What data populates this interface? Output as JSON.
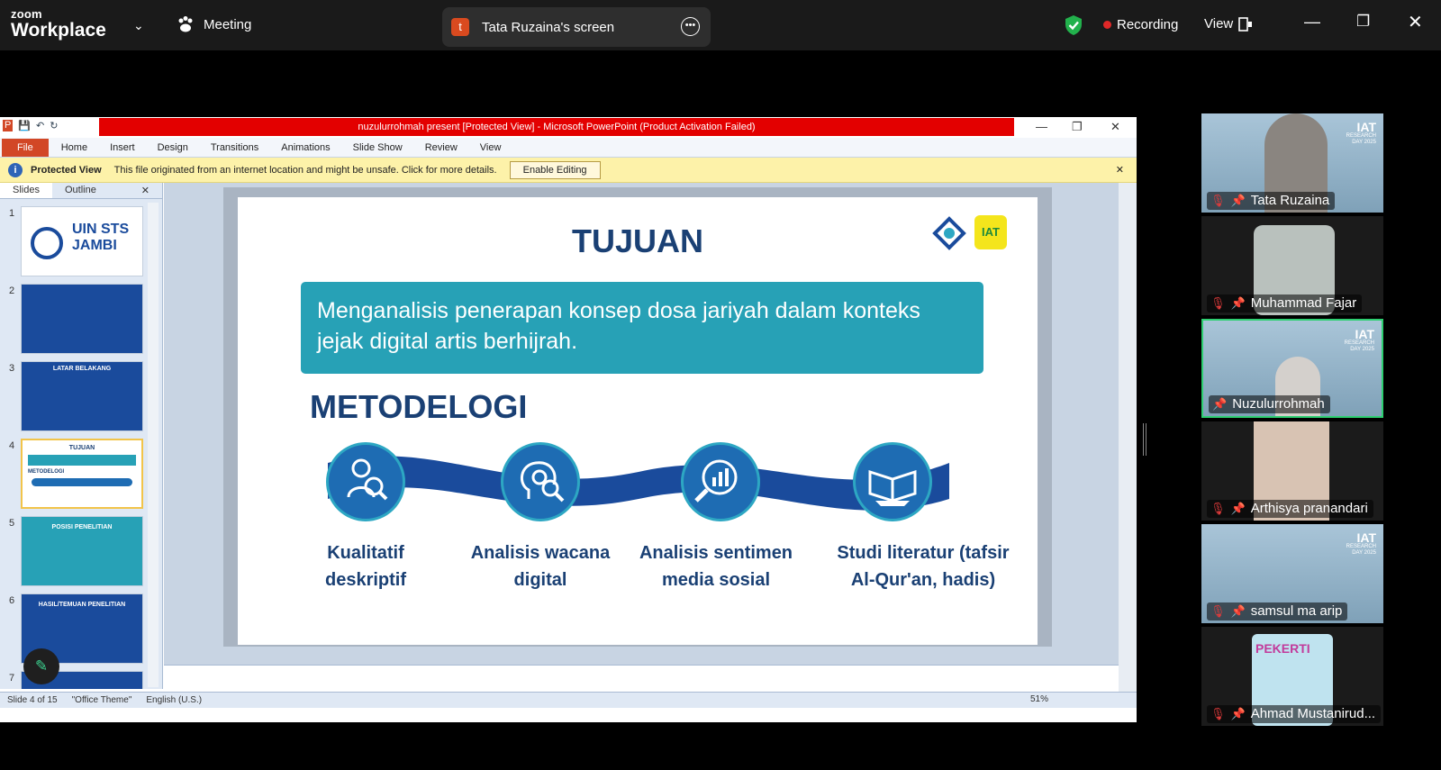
{
  "zoom": {
    "brand_top": "zoom",
    "brand_bottom": "Workplace",
    "meeting_label": "Meeting",
    "share_initial": "t",
    "share_label": "Tata Ruzaina's screen",
    "recording_label": "Recording",
    "view_label": "View"
  },
  "ppt": {
    "window_title": "nuzulurrohmah present [Protected View] - Microsoft PowerPoint (Product Activation Failed)",
    "ribbon_tabs": [
      "File",
      "Home",
      "Insert",
      "Design",
      "Transitions",
      "Animations",
      "Slide Show",
      "Review",
      "View"
    ],
    "protected_label": "Protected View",
    "protected_message": "This file originated from an internet location and might be unsafe. Click for more details.",
    "enable_editing": "Enable Editing",
    "panel_tabs": [
      "Slides",
      "Outline"
    ],
    "slide_numbers": [
      "1",
      "2",
      "3",
      "4",
      "5",
      "6",
      "7"
    ],
    "thumb1_line1": "UIN STS",
    "thumb1_line2": "JAMBI",
    "thumb3_title": "LATAR BELAKANG",
    "thumb4_title": "TUJUAN",
    "thumb4_sub": "METODELOGI",
    "thumb5_title": "POSISI PENELITIAN",
    "thumb6_title": "HASIL/TEMUAN PENELITIAN",
    "status_slide": "Slide 4 of 15",
    "status_theme": "\"Office Theme\"",
    "status_lang": "English (U.S.)",
    "zoom_level": "51%"
  },
  "slide": {
    "title": "TUJUAN",
    "objective": "Menganalisis penerapan konsep dosa jariyah dalam konteks jejak digital artis berhijrah.",
    "section": "METODELOGI",
    "logo_text": "IAT",
    "methods": [
      {
        "label": "Kualitatif deskriptif",
        "icon": "person-magnifier-icon"
      },
      {
        "label": "Analisis wacana digital",
        "icon": "head-gears-icon"
      },
      {
        "label": "Analisis sentimen media sosial",
        "icon": "chart-magnifier-icon"
      },
      {
        "label": "Studi literatur (tafsir Al-Qur'an, hadis)",
        "icon": "open-book-icon"
      }
    ]
  },
  "participants": [
    {
      "name": "Tata Ruzaina",
      "muted": true
    },
    {
      "name": "Muhammad Fajar",
      "muted": true
    },
    {
      "name": "Nuzulurrohmah",
      "muted": false,
      "active": true
    },
    {
      "name": "Arthisya pranandari",
      "muted": true
    },
    {
      "name": "samsul ma arip",
      "muted": true
    },
    {
      "name": "Ahmad Mustanirud...",
      "muted": true
    }
  ],
  "tile_badge": {
    "title": "IAT",
    "line1": "RESEARCH",
    "line2": "DAY 2025"
  },
  "pekerti_label": "PEKERTI",
  "colors": {
    "accent_green": "#2ecf71",
    "recording_red": "#e02828",
    "ppt_red_bar": "#e30000",
    "slide_navy": "#1a4074",
    "slide_teal": "#27a1b6"
  }
}
